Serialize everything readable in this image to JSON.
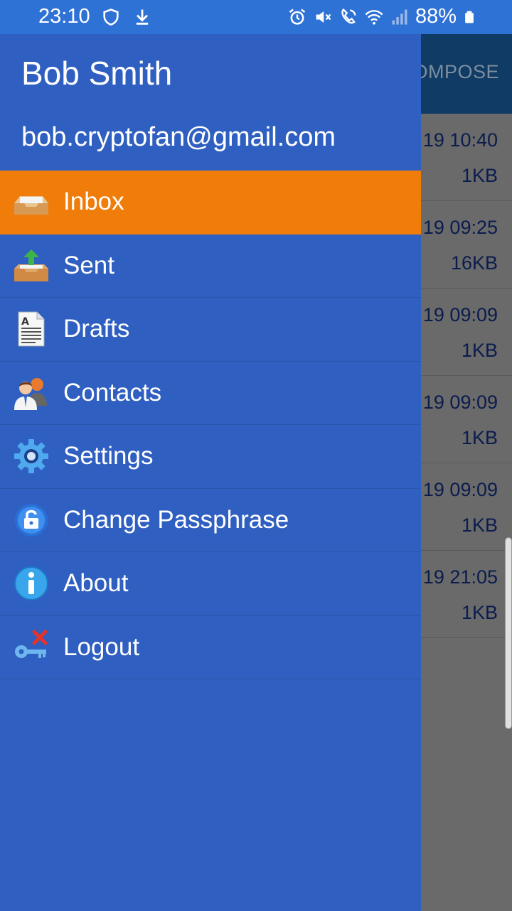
{
  "status_bar": {
    "time": "23:10",
    "battery": "88%",
    "left_icons": [
      "shield-icon",
      "download-icon"
    ],
    "right_icons": [
      "alarm-icon",
      "mute-icon",
      "wifi-call-icon",
      "wifi-icon",
      "signal-icon",
      "battery-icon"
    ]
  },
  "background_app": {
    "compose_label": "OMPOSE",
    "rows": [
      {
        "date": "19 10:40",
        "size": "1KB"
      },
      {
        "date": "19 09:25",
        "size": "16KB"
      },
      {
        "date": "19 09:09",
        "size": "1KB"
      },
      {
        "date": "19 09:09",
        "size": "1KB"
      },
      {
        "date": "19 09:09",
        "size": "1KB"
      },
      {
        "date": "19 21:05",
        "size": "1KB"
      }
    ]
  },
  "drawer": {
    "user_name": "Bob Smith",
    "user_email": "bob.cryptofan@gmail.com",
    "menu": [
      {
        "label": "Inbox",
        "icon": "inbox-icon",
        "active": true
      },
      {
        "label": "Sent",
        "icon": "sent-icon",
        "active": false
      },
      {
        "label": "Drafts",
        "icon": "drafts-icon",
        "active": false
      },
      {
        "label": "Contacts",
        "icon": "contacts-icon",
        "active": false
      },
      {
        "label": "Settings",
        "icon": "settings-icon",
        "active": false
      },
      {
        "label": "Change Passphrase",
        "icon": "lock-icon",
        "active": false
      },
      {
        "label": "About",
        "icon": "info-icon",
        "active": false
      },
      {
        "label": "Logout",
        "icon": "logout-key-icon",
        "active": false
      }
    ]
  },
  "colors": {
    "status_bar": "#2f72d6",
    "drawer_bg": "#2f5fc0",
    "active_item": "#f07c0a",
    "scrim": "#6a6a6a"
  }
}
